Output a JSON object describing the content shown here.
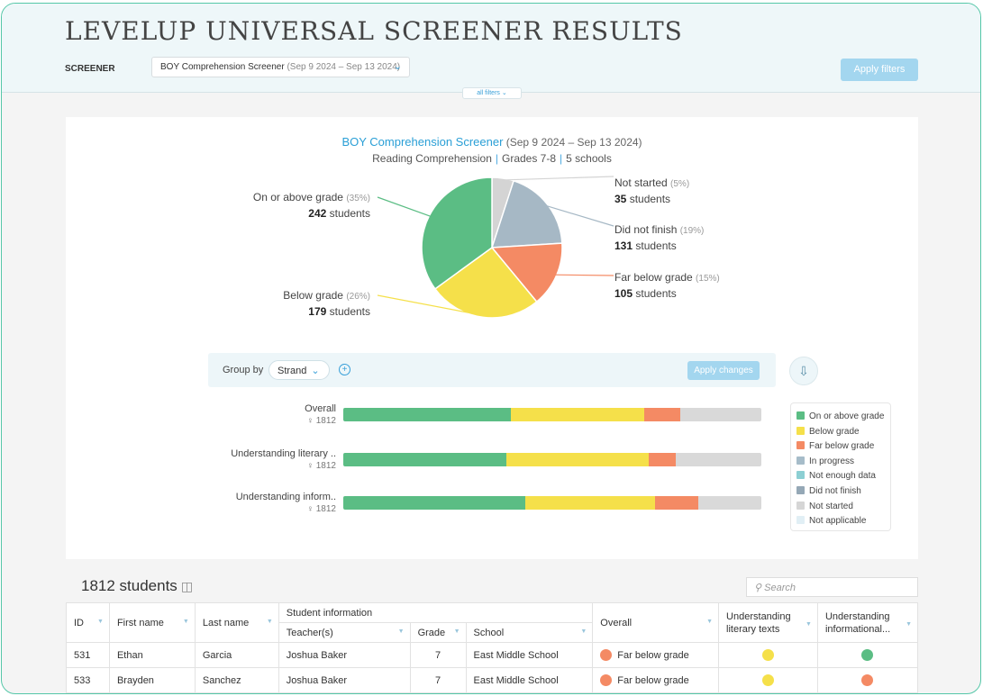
{
  "page": {
    "title": "LEVELUP UNIVERSAL SCREENER RESULTS",
    "screener_label": "SCREENER",
    "screener_value": "BOY Comprehension Screener",
    "screener_dates": "(Sep 9 2024 – Sep 13 2024)",
    "apply_filters": "Apply filters",
    "all_filters": "all filters"
  },
  "summary": {
    "title": "BOY Comprehension Screener",
    "dates": "(Sep 9 2024 – Sep 13 2024)",
    "subject": "Reading Comprehension",
    "grades": "Grades 7-8",
    "schools": "5 schools"
  },
  "chart_data": [
    {
      "type": "pie",
      "slices": [
        {
          "label": "Not started",
          "percent": 5,
          "pct_text": "(5%)",
          "count": 35,
          "count_text": "35",
          "unit": "students",
          "color": "#d4d4d4"
        },
        {
          "label": "Did not finish",
          "percent": 19,
          "pct_text": "(19%)",
          "count": 131,
          "count_text": "131",
          "unit": "students",
          "color": "#a6b8c5"
        },
        {
          "label": "Far below grade",
          "percent": 15,
          "pct_text": "(15%)",
          "count": 105,
          "count_text": "105",
          "unit": "students",
          "color": "#f48a64"
        },
        {
          "label": "Below grade",
          "percent": 26,
          "pct_text": "(26%)",
          "count": 179,
          "count_text": "179",
          "unit": "students",
          "color": "#f5e04a"
        },
        {
          "label": "On or above grade",
          "percent": 35,
          "pct_text": "(35%)",
          "count": 242,
          "count_text": "242",
          "unit": "students",
          "color": "#5bbd84"
        }
      ]
    },
    {
      "type": "bar",
      "stacked": true,
      "orientation": "horizontal",
      "categories": [
        "Overall",
        "Understanding literary ..",
        "Understanding inform.."
      ],
      "counts": [
        "1812",
        "1812",
        "1812"
      ],
      "series": [
        {
          "name": "On or above grade",
          "color": "#5bbd84",
          "values": [
            40,
            39,
            43.5
          ]
        },
        {
          "name": "Below grade",
          "color": "#f5e04a",
          "values": [
            32,
            34,
            31
          ]
        },
        {
          "name": "Far below grade",
          "color": "#f48a64",
          "values": [
            8.5,
            6.5,
            10.5
          ]
        },
        {
          "name": "Not started",
          "color": "#d9d9d9",
          "values": [
            19.5,
            20.5,
            15
          ]
        }
      ]
    }
  ],
  "groupby": {
    "label": "Group by",
    "value": "Strand",
    "apply": "Apply changes"
  },
  "legend": [
    {
      "label": "On or above grade",
      "color": "#5bbd84"
    },
    {
      "label": "Below grade",
      "color": "#f5e04a"
    },
    {
      "label": "Far below grade",
      "color": "#f48a64"
    },
    {
      "label": "In progress",
      "color": "#a6bcc9"
    },
    {
      "label": "Not enough data",
      "color": "#8ccfd3"
    },
    {
      "label": "Did not finish",
      "color": "#95a8b6"
    },
    {
      "label": "Not started",
      "color": "#d6d6d6"
    },
    {
      "label": "Not applicable",
      "color": "#e1eff5"
    }
  ],
  "table": {
    "count": "1812 students",
    "search_placeholder": "Search",
    "headers": {
      "id": "ID",
      "first": "First name",
      "last": "Last name",
      "group": "Student information",
      "teacher": "Teacher(s)",
      "grade": "Grade",
      "school": "School",
      "overall": "Overall",
      "lit": "Understanding literary texts",
      "info": "Understanding informational..."
    },
    "rows": [
      {
        "id": "531",
        "first": "Ethan",
        "last": "Garcia",
        "teacher": "Joshua Baker",
        "grade": "7",
        "school": "East Middle School",
        "overall": "Far below grade",
        "overall_color": "#f48a64",
        "lit_color": "#f5e04a",
        "info_color": "#5bbd84"
      },
      {
        "id": "533",
        "first": "Brayden",
        "last": "Sanchez",
        "teacher": "Joshua Baker",
        "grade": "7",
        "school": "East Middle School",
        "overall": "Far below grade",
        "overall_color": "#f48a64",
        "lit_color": "#f5e04a",
        "info_color": "#f48a64"
      }
    ]
  }
}
